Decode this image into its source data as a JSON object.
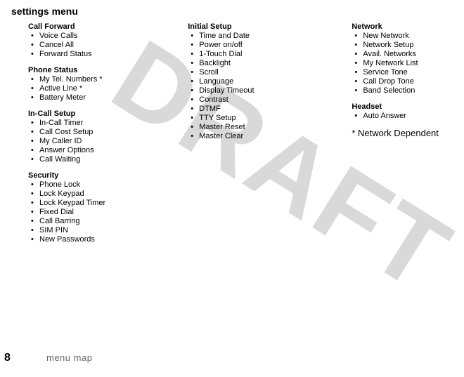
{
  "heading": "settings menu",
  "watermark": "DRAFT",
  "columns": [
    {
      "sections": [
        {
          "title": "Call Forward",
          "items": [
            "Voice Calls",
            "Cancel All",
            "Forward Status"
          ]
        },
        {
          "title": "Phone Status",
          "items": [
            "My Tel. Numbers *",
            "Active Line *",
            "Battery Meter"
          ]
        },
        {
          "title": "In-Call Setup",
          "items": [
            "In-Call Timer",
            "Call Cost Setup",
            "My Caller ID",
            "Answer Options",
            "Call Waiting"
          ]
        },
        {
          "title": "Security",
          "items": [
            "Phone Lock",
            "Lock Keypad",
            "Lock Keypad Timer",
            "Fixed Dial",
            "Call Barring",
            "SIM PIN",
            "New Passwords"
          ]
        }
      ]
    },
    {
      "sections": [
        {
          "title": "Initial Setup",
          "items": [
            "Time and Date",
            "Power on/off",
            "1-Touch Dial",
            "Backlight",
            "Scroll",
            "Language",
            "Display Timeout",
            "Contrast",
            "DTMF",
            "TTY Setup",
            "Master Reset",
            "Master Clear"
          ]
        }
      ]
    },
    {
      "sections": [
        {
          "title": "Network",
          "items": [
            "New Network",
            "Network Setup",
            "Avail. Networks",
            "My Network List",
            "Service Tone",
            "Call Drop Tone",
            "Band Selection"
          ]
        },
        {
          "title": "Headset",
          "items": [
            "Auto Answer"
          ]
        }
      ],
      "footnote": "* Network Dependent"
    }
  ],
  "footer": {
    "page": "8",
    "label": "menu map"
  }
}
